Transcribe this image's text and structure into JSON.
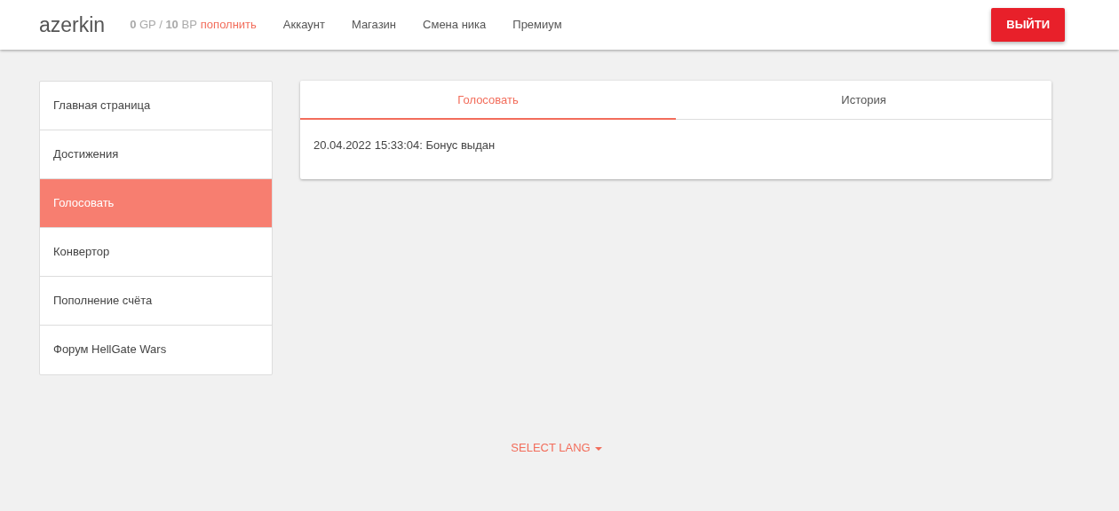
{
  "navbar": {
    "brand": "azerkin",
    "balance": "**0** GP / **10** BP",
    "topup_link": "пополнить",
    "links": [
      "Аккаунт",
      "Магазин",
      "Смена ника",
      "Премиум"
    ],
    "logout_button": "ВЫЙТИ"
  },
  "sidebar": {
    "items": [
      {
        "label": "Главная страница",
        "selected": false
      },
      {
        "label": "Достижения",
        "selected": false
      },
      {
        "label": "Голосовать",
        "selected": true
      },
      {
        "label": "Конвертор",
        "selected": false
      },
      {
        "label": "Пополнение счёта",
        "selected": false
      },
      {
        "label": "Форум HellGate Wars",
        "selected": false
      }
    ]
  },
  "panel": {
    "tabs": [
      {
        "label": "Голосовать",
        "selected": true
      },
      {
        "label": "История",
        "selected": false
      }
    ],
    "entries": [
      "20.04.2022 15:33:04: Бонус выдан"
    ]
  },
  "footer": {
    "lang_selector": "SELECT LANG"
  }
}
